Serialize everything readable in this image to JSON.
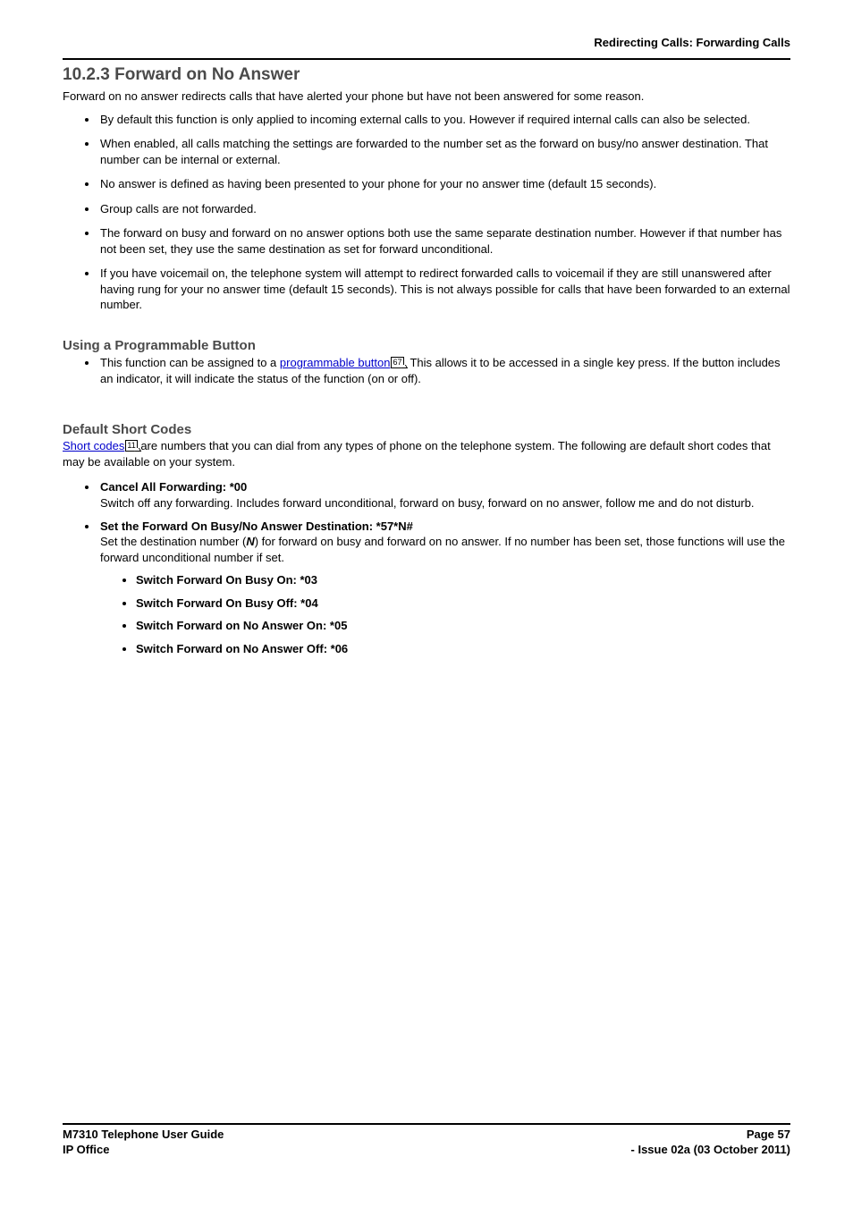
{
  "breadcrumb": "Redirecting Calls: Forwarding Calls",
  "section_number": "10.2.3",
  "section_title": "Forward on No Answer",
  "intro": "Forward on no answer redirects calls that have alerted your phone but have not been answered for some reason.",
  "main_bullets": [
    "By default this function is only applied to incoming external calls to you. However if required internal calls can also be selected.",
    "When enabled, all calls matching the settings are forwarded to the number set as the forward on busy/no answer destination. That number can be internal or external.",
    "No answer is defined as having been presented to your phone for your no answer time (default 15 seconds).",
    "Group calls are not forwarded.",
    "The forward on busy and forward on no answer options both use the same separate destination number. However if that number has not been set, they use the same destination as set for forward unconditional.",
    "If you have voicemail on, the telephone system will attempt to redirect forwarded calls to voicemail if they are still unanswered after having rung for your no answer time (default 15 seconds). This is not always possible for calls that have been forwarded to an external number."
  ],
  "prog_button": {
    "heading": "Using a Programmable Button",
    "bullet_pre": "This function can be assigned to a ",
    "link_text": "programmable button",
    "link_pageref": "67",
    "bullet_post": ". This allows it to be accessed in a single key press. If the button includes an indicator, it will indicate the status of the function (on or off)."
  },
  "short_codes": {
    "heading": "Default Short Codes",
    "link_text": "Short codes",
    "link_pageref": "11",
    "para_rest": " are numbers that you can dial from any types of phone on the telephone system. The following are default short codes that may be available on your system.",
    "items": [
      {
        "title": "Cancel All Forwarding: *00",
        "desc": "Switch off any forwarding. Includes forward unconditional, forward on busy, forward on no answer, follow me and do not disturb."
      },
      {
        "title": "Set the Forward On Busy/No Answer Destination: *57*N#",
        "desc_pre": "Set the destination number (",
        "desc_var": "N",
        "desc_post": ") for forward on busy and forward on no answer. If no number has been set, those functions will use the forward unconditional number if set.",
        "sub": [
          "Switch Forward On Busy On: *03",
          "Switch Forward On Busy Off: *04",
          "Switch Forward on No Answer On: *05",
          "Switch Forward on No Answer Off: *06"
        ]
      }
    ]
  },
  "footer": {
    "left1": "M7310 Telephone User Guide",
    "right1": "Page 57",
    "left2": "IP Office",
    "right2": "- Issue 02a (03 October 2011)"
  }
}
